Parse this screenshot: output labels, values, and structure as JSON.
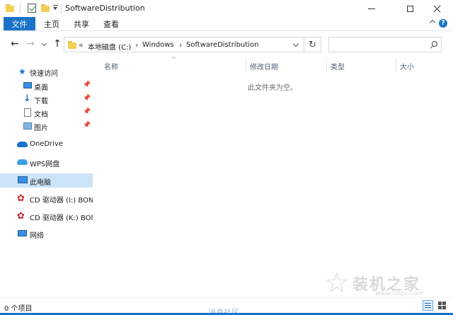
{
  "window": {
    "title": "SoftwareDistribution"
  },
  "ribbon": {
    "tabs": [
      "文件",
      "主页",
      "共享",
      "查看"
    ],
    "help_label": "?"
  },
  "address": {
    "overflow": "«",
    "crumbs": [
      "本地磁盘 (C:)",
      "Windows",
      "SoftwareDistribution"
    ],
    "separator": "›",
    "search_placeholder": ""
  },
  "navpane": {
    "quick_access": "快速访问",
    "quick_items": [
      "桌面",
      "下载",
      "文档",
      "图片"
    ],
    "onedrive": "OneDrive",
    "wps": "WPS网盘",
    "this_pc": "此电脑",
    "drives": [
      "CD 驱动器 (I:) BONJ",
      "CD 驱动器 (K:) BON"
    ],
    "network": "网络"
  },
  "columns": [
    "名称",
    "修改日期",
    "类型",
    "大小"
  ],
  "content": {
    "empty_message": "此文件夹为空。"
  },
  "status": {
    "items_text": "0 个项目"
  },
  "watermark": {
    "text": "装机之家",
    "url": "www.lotpc.com",
    "community": "消息社区"
  },
  "colors": {
    "accent": "#1a73c9",
    "selected": "#cce4f7",
    "folder": "#f4cf55"
  }
}
